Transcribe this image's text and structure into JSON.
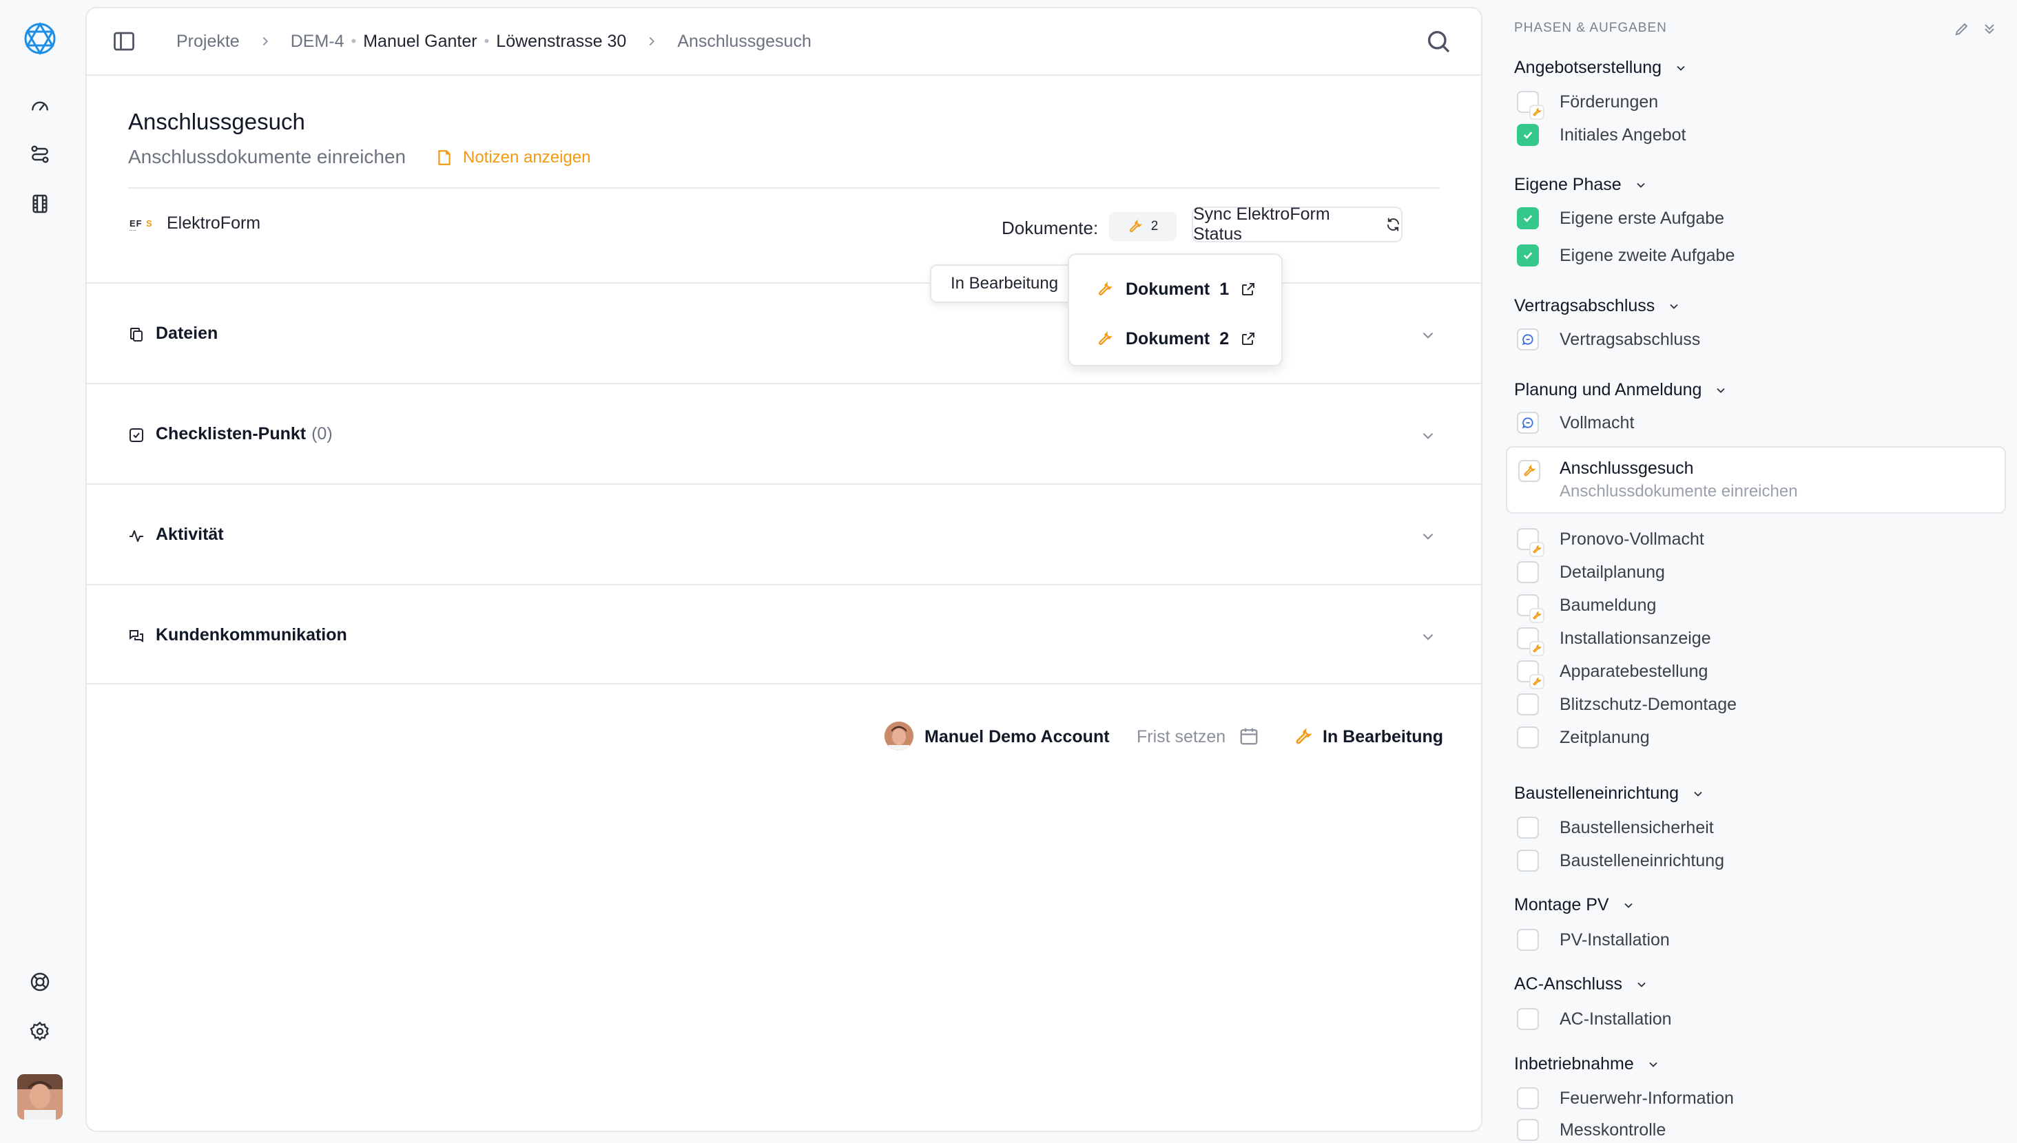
{
  "breadcrumb": {
    "projects": "Projekte",
    "project_id": "DEM-4",
    "customer": "Manuel Ganter",
    "address": "Löwenstrasse 30",
    "current": "Anschlussgesuch"
  },
  "task": {
    "title": "Anschlussgesuch",
    "subtitle": "Anschlussdokumente einreichen",
    "notes_link": "Notizen anzeigen"
  },
  "integration": {
    "logo_text": "EFS",
    "name": "ElektroForm",
    "documents_label": "Dokumente:",
    "documents_count": "2",
    "sync_label": "Sync ElektroForm Status"
  },
  "tooltip": "In Bearbeitung",
  "documents": [
    {
      "label": "Dokument",
      "number": "1"
    },
    {
      "label": "Dokument",
      "number": "2"
    }
  ],
  "sections": {
    "files": "Dateien",
    "checklist": "Checklisten-Punkt",
    "checklist_count": "(0)",
    "activity": "Aktivität",
    "communication": "Kundenkommunikation"
  },
  "footer": {
    "assignee": "Manuel Demo Account",
    "deadline": "Frist setzen",
    "status": "In Bearbeitung"
  },
  "right_panel": {
    "header": "PHASEN & AUFGABEN",
    "phases": {
      "p1": "Angebotserstellung",
      "p2": "Eigene Phase",
      "p3": "Vertragsabschluss",
      "p4": "Planung und Anmeldung",
      "p5": "Baustelleneinrichtung",
      "p6": "Montage PV",
      "p7": "AC-Anschluss",
      "p8": "Inbetriebnahme"
    },
    "tasks": {
      "t1": "Förderungen",
      "t2": "Initiales Angebot",
      "t3": "Eigene erste Aufgabe",
      "t4": "Eigene zweite Aufgabe",
      "t5": "Vertragsabschluss",
      "t6": "Vollmacht",
      "t7": "Pronovo-Vollmacht",
      "t8": "Detailplanung",
      "t9": "Baumeldung",
      "t10": "Installationsanzeige",
      "t11": "Apparatebestellung",
      "t12": "Blitzschutz-Demontage",
      "t13": "Zeitplanung",
      "t14": "Baustellensicherheit",
      "t15": "Baustelleneinrichtung",
      "t16": "PV-Installation",
      "t17": "AC-Installation",
      "t18": "Feuerwehr-Information",
      "t19": "Messkontrolle"
    },
    "active_task": {
      "title": "Anschlussgesuch",
      "subtitle": "Anschlussdokumente einreichen"
    }
  },
  "colors": {
    "accent_orange": "#f29a14",
    "check_green": "#34c98a",
    "brand_blue": "#1e8fe6",
    "chat_blue": "#3b6fe0"
  }
}
